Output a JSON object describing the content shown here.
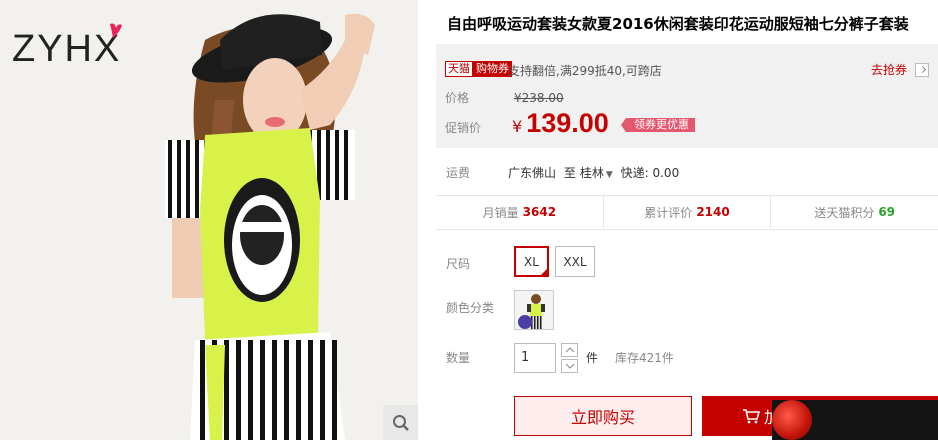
{
  "brand": {
    "logo_text": "ZYHX"
  },
  "product": {
    "title": "自由呼吸运动套装女款夏2016休闲套装印花运动服短袖七分裤子套装"
  },
  "promo": {
    "tag_tmall": "天猫",
    "tag_coupon": "购物券",
    "text": "支持翻倍,满299抵40,可跨店",
    "grab_label": "去抢券"
  },
  "price": {
    "label": "价格",
    "original": "¥238.00",
    "promo_label": "促销价",
    "currency": "¥",
    "promo_value": "139.00",
    "coupon_badge": "领券更优惠"
  },
  "shipping": {
    "label": "运费",
    "from": "广东佛山",
    "to_word": "至",
    "to": "桂林",
    "fee": "快递: 0.00"
  },
  "stats": {
    "monthly_label": "月销量",
    "monthly_value": "3642",
    "reviews_label": "累计评价",
    "reviews_value": "2140",
    "points_label": "送天猫积分",
    "points_value": "69"
  },
  "sku": {
    "size_label": "尺码",
    "sizes": [
      "XL",
      "XXL"
    ],
    "selected_size": "XL",
    "color_label": "颜色分类"
  },
  "quantity": {
    "label": "数量",
    "value": "1",
    "unit": "件",
    "stock": "库存421件"
  },
  "actions": {
    "buy_now": "立即购买",
    "add_cart": "加"
  },
  "colors": {
    "accent": "#c40000",
    "price_bg": "#f1f1f1",
    "green_points": "#28a325"
  }
}
